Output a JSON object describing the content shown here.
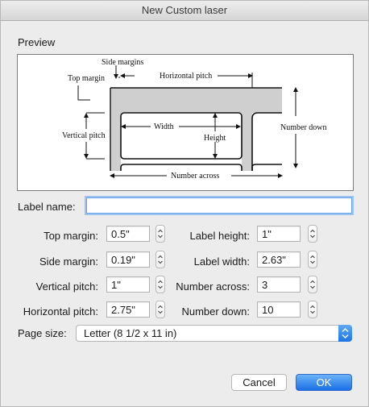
{
  "window": {
    "title": "New Custom laser"
  },
  "preview": {
    "label": "Preview",
    "diagram": {
      "side_margins": "Side margins",
      "top_margin": "Top margin",
      "horizontal_pitch": "Horizontal pitch",
      "vertical_pitch": "Vertical pitch",
      "width": "Width",
      "height": "Height",
      "number_down": "Number down",
      "number_across": "Number across"
    }
  },
  "form": {
    "label_name": {
      "label": "Label name:",
      "value": ""
    },
    "top_margin": {
      "label": "Top margin:",
      "value": "0.5\""
    },
    "side_margin": {
      "label": "Side margin:",
      "value": "0.19\""
    },
    "vertical_pitch": {
      "label": "Vertical pitch:",
      "value": "1\""
    },
    "horizontal_pitch": {
      "label": "Horizontal pitch:",
      "value": "2.75\""
    },
    "label_height": {
      "label": "Label height:",
      "value": "1\""
    },
    "label_width": {
      "label": "Label width:",
      "value": "2.63\""
    },
    "number_across": {
      "label": "Number across:",
      "value": "3"
    },
    "number_down": {
      "label": "Number down:",
      "value": "10"
    },
    "page_size": {
      "label": "Page size:",
      "value": "Letter (8 1/2 x 11 in)"
    }
  },
  "buttons": {
    "cancel": "Cancel",
    "ok": "OK"
  },
  "colors": {
    "accent": "#1a6fe5",
    "focus_ring": "#9cc4f2"
  }
}
